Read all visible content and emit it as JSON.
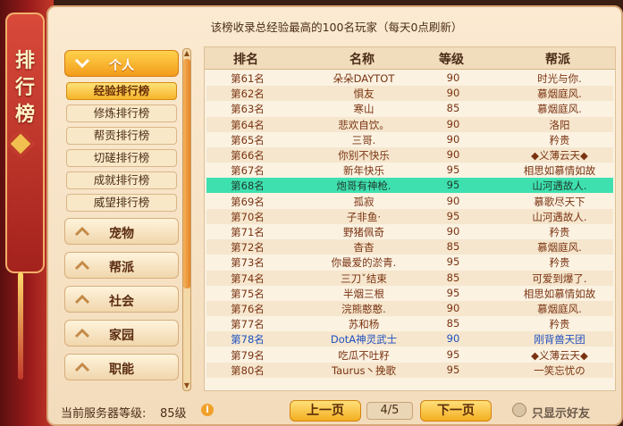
{
  "sidebar": {
    "title_chars": [
      "排",
      "行",
      "榜"
    ]
  },
  "header": {
    "notice": "该榜收录总经验最高的100名玩家（每天0点刷新）"
  },
  "categories": [
    {
      "label": "个人",
      "active": true,
      "subs": [
        {
          "label": "经验排行榜",
          "active": true
        },
        {
          "label": "修炼排行榜",
          "active": false
        },
        {
          "label": "帮贡排行榜",
          "active": false
        },
        {
          "label": "切磋排行榜",
          "active": false
        },
        {
          "label": "成就排行榜",
          "active": false
        },
        {
          "label": "威望排行榜",
          "active": false
        }
      ]
    },
    {
      "label": "宠物",
      "active": false
    },
    {
      "label": "帮派",
      "active": false
    },
    {
      "label": "社会",
      "active": false
    },
    {
      "label": "家园",
      "active": false
    },
    {
      "label": "职能",
      "active": false
    }
  ],
  "table": {
    "headers": [
      "排名",
      "名称",
      "等级",
      "帮派"
    ],
    "rows": [
      [
        "第61名",
        "朵朵DAYTOT",
        "90",
        "时光与你."
      ],
      [
        "第62名",
        "惧友",
        "90",
        "慕烟庭风."
      ],
      [
        "第63名",
        "寒山",
        "85",
        "慕烟庭风."
      ],
      [
        "第64名",
        "悲欢自饮。",
        "90",
        "洛阳"
      ],
      [
        "第65名",
        "三哥.",
        "90",
        "矜贵"
      ],
      [
        "第66名",
        "你别不快乐",
        "90",
        "◆义薄云天◆"
      ],
      [
        "第67名",
        "新年快乐",
        "95",
        "相思如慕情如故"
      ],
      [
        "第68名",
        "炮哥有神枪.",
        "95",
        "山河遇故人."
      ],
      [
        "第69名",
        "孤寂",
        "90",
        "慕歌尽天下"
      ],
      [
        "第70名",
        "子非鱼·",
        "95",
        "山河遇故人."
      ],
      [
        "第71名",
        "野猪佩奇",
        "90",
        "矜贵"
      ],
      [
        "第72名",
        "杳杳",
        "85",
        "慕烟庭风."
      ],
      [
        "第73名",
        "你最爱的淤青.",
        "95",
        "矜贵"
      ],
      [
        "第74名",
        "三刀ˇ结束",
        "85",
        "可爱到爆了."
      ],
      [
        "第75名",
        "半烟三根",
        "95",
        "相思如慕情如故"
      ],
      [
        "第76名",
        "浣熊憨憨.",
        "90",
        "慕烟庭风."
      ],
      [
        "第77名",
        "苏和杨",
        "85",
        "矜贵"
      ],
      [
        "第78名",
        "DotA神灵武士",
        "90",
        "刚背兽天团"
      ],
      [
        "第79名",
        "吃瓜不吐籽",
        "95",
        "◆义薄云天◆"
      ],
      [
        "第80名",
        "Taurus丶挽歌",
        "95",
        "一笑忘忧の"
      ]
    ],
    "highlight_row": 7,
    "blue_row": 17
  },
  "footer": {
    "server_level_label": "当前服务器等级:",
    "server_level_value": "85级",
    "prev_label": "上一页",
    "page_indicator": "4/5",
    "next_label": "下一页",
    "friends_only_label": "只显示好友"
  },
  "colors": {
    "highlight": "#3fe0b0",
    "accent": "#f3ae22"
  }
}
